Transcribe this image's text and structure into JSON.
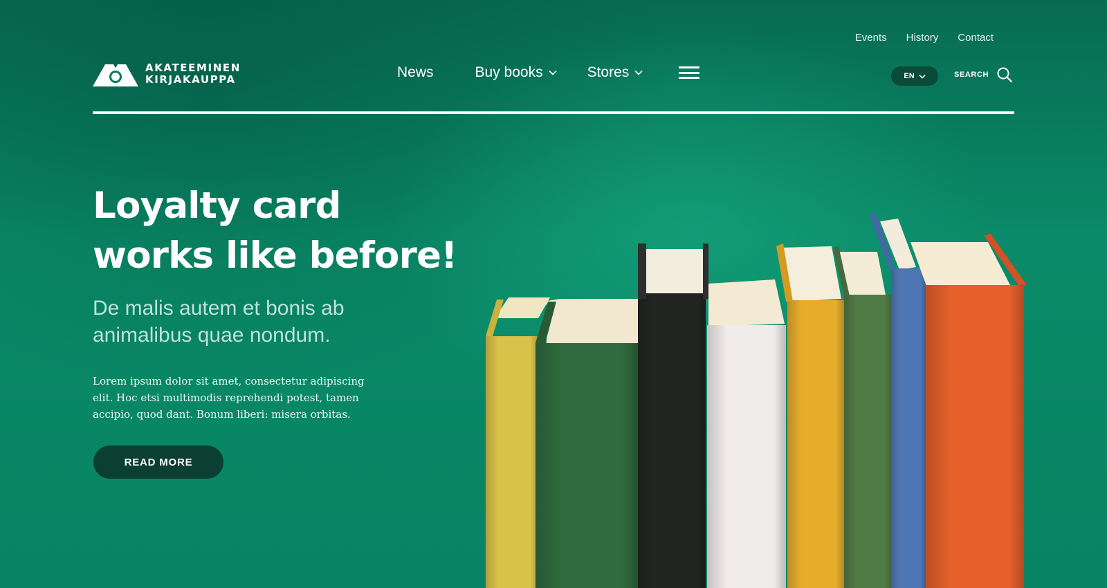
{
  "brand": {
    "line1": "AKATEEMINEN",
    "line2": "KIRJAKAUPPA"
  },
  "utility_nav": [
    {
      "label": "Events"
    },
    {
      "label": "History"
    },
    {
      "label": "Contact"
    }
  ],
  "main_nav": {
    "news": "News",
    "buy_books": "Buy books",
    "stores": "Stores"
  },
  "language": {
    "selected": "EN"
  },
  "search": {
    "label": "SEARCH"
  },
  "hero": {
    "title_line1": "Loyalty card",
    "title_line2": "works like before!",
    "subtitle": "De malis autem et bonis ab animalibus quae nondum.",
    "body": "Lorem ipsum dolor sit amet, consectetur adipiscing elit. Hoc etsi multimodis reprehendi potest, tamen accipio, quod dant. Bonum liberi: misera orbitas.",
    "cta_label": "READ MORE"
  },
  "colors": {
    "background": "#0a8a68",
    "cta_background": "#0b3f31",
    "language_pill": "#0b4a39",
    "subtitle_text": "#bfe3d8",
    "book_yellow_pale": "#d9c24a",
    "book_green": "#2f6b3f",
    "book_black": "#232523",
    "book_white": "#f1ecec",
    "book_mustard": "#e7ad2a",
    "book_olive": "#4f7a46",
    "book_blue": "#4f76b4",
    "book_orange": "#e5602b"
  },
  "icons": {
    "logo": "akateeminen-logo-mark",
    "dropdown": "chevron-down-icon",
    "menu": "hamburger-menu-icon",
    "search": "magnifier-icon"
  }
}
